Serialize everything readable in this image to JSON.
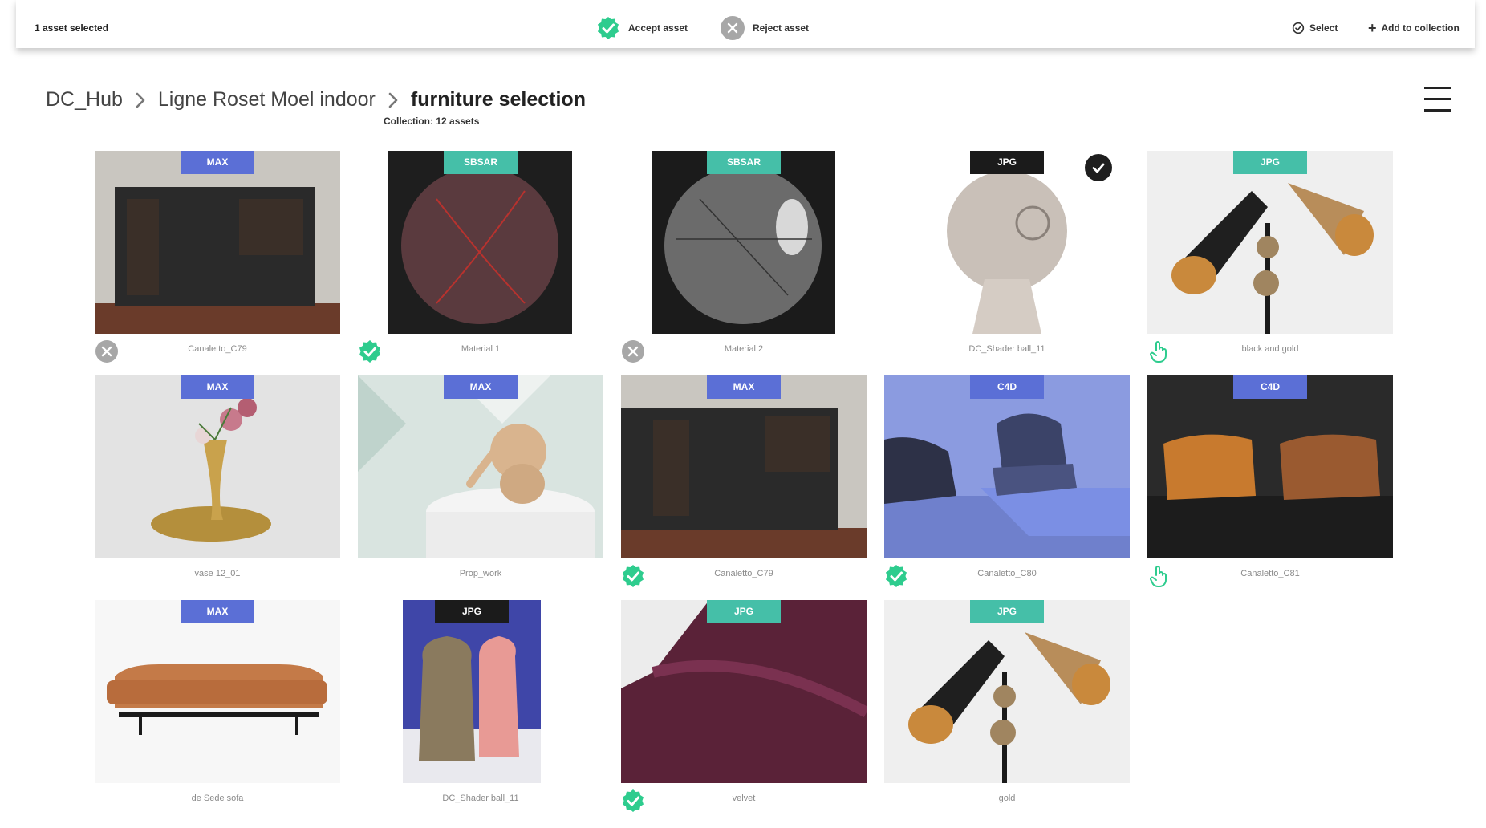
{
  "topbar": {
    "selection_count": "1 asset selected",
    "accept_label": "Accept asset",
    "reject_label": "Reject asset",
    "select_label": "Select",
    "add_label": "Add to collection"
  },
  "breadcrumb": {
    "items": [
      "DC_Hub",
      "Ligne Roset Moel indoor"
    ],
    "current": "furniture selection",
    "subtitle": "Collection: 12 assets"
  },
  "colors": {
    "accent_green": "#2ecc8e",
    "badge_blue": "#5b6fd6",
    "badge_teal": "#45bfa8",
    "badge_dark": "#1b1b1b"
  },
  "assets": [
    {
      "name": "Canaletto_C79",
      "format": "MAX",
      "status": "rejected"
    },
    {
      "name": "Material 1",
      "format": "SBSAR",
      "status": "accepted"
    },
    {
      "name": "Material 2",
      "format": "SBSAR",
      "status": "rejected"
    },
    {
      "name": "DC_Shader ball_11",
      "format": "JPG",
      "status": "selected"
    },
    {
      "name": "black and gold",
      "format": "JPG",
      "status": "hover"
    },
    {
      "name": "vase 12_01",
      "format": "MAX",
      "status": "none"
    },
    {
      "name": "Prop_work",
      "format": "MAX",
      "status": "none"
    },
    {
      "name": "Canaletto_C79",
      "format": "MAX",
      "status": "accepted"
    },
    {
      "name": "Canaletto_C80",
      "format": "C4D",
      "status": "accepted"
    },
    {
      "name": "Canaletto_C81",
      "format": "C4D",
      "status": "hover"
    },
    {
      "name": "de Sede sofa",
      "format": "MAX",
      "status": "none"
    },
    {
      "name": "DC_Shader ball_11",
      "format": "JPG",
      "status": "none"
    },
    {
      "name": "velvet",
      "format": "JPG",
      "status": "accepted"
    },
    {
      "name": "gold",
      "format": "JPG",
      "status": "none"
    }
  ]
}
